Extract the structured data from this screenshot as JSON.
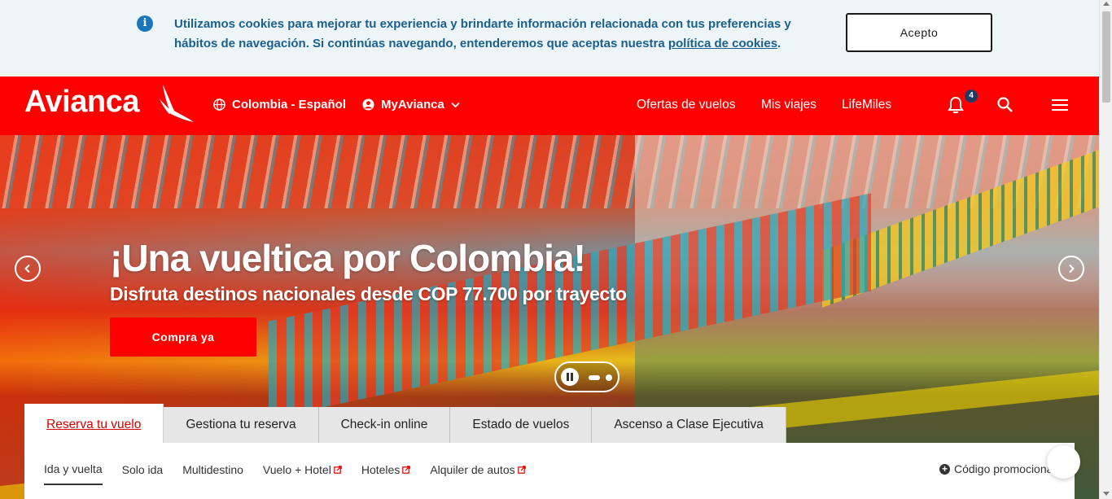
{
  "cookie_banner": {
    "text": "Utilizamos cookies para mejorar tu experiencia y brindarte información relacionada con tus preferencias y hábitos de navegación. Si continúas navegando, entenderemos que aceptas nuestra ",
    "link": "política de cookies",
    "trailing": ".",
    "accept_label": "Acepto"
  },
  "header": {
    "logo": "Avianca",
    "region": "Colombia - Español",
    "account": "MyAvianca",
    "nav": [
      "Ofertas de vuelos",
      "Mis viajes",
      "LifeMiles"
    ],
    "notifications_count": "4"
  },
  "hero": {
    "title": "¡Una vueltica por Colombia!",
    "subtitle": "Disfruta destinos nacionales desde COP 77.700 por trayecto",
    "cta": "Compra ya"
  },
  "tabs": [
    "Reserva tu vuelo",
    "Gestiona tu reserva",
    "Check-in online",
    "Estado de vuelos",
    "Ascenso a Clase Ejecutiva"
  ],
  "subtabs": [
    "Ida y vuelta",
    "Solo ida",
    "Multidestino",
    "Vuelo + Hotel",
    "Hoteles",
    "Alquiler de autos"
  ],
  "promo_code": "Código promociona",
  "colors": {
    "brand_red": "#ff0000",
    "cookie_text": "#1a5f8e",
    "badge": "#1e3b63"
  }
}
